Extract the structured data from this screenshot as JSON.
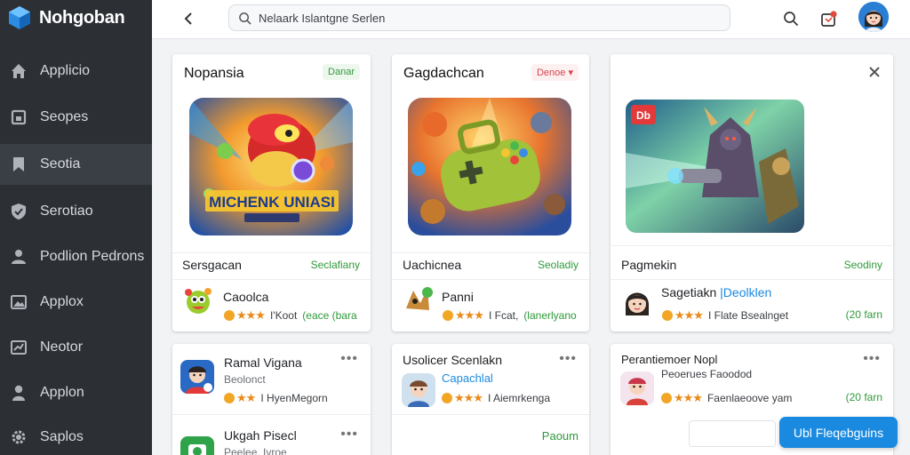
{
  "brand": {
    "name": "Nohgoban",
    "logo_icon": "cube-logo-icon",
    "color": "#2a8de3"
  },
  "sidebar": {
    "items": [
      {
        "label": "Applicio",
        "icon": "home-icon"
      },
      {
        "label": "Seopes",
        "icon": "square-icon"
      },
      {
        "label": "Seotia",
        "icon": "bookmark-icon",
        "active": true
      },
      {
        "label": "Serotiao",
        "icon": "shield-icon"
      },
      {
        "label": "Podlion Pedrons",
        "icon": "user-icon"
      },
      {
        "label": "Applox",
        "icon": "image-icon"
      },
      {
        "label": "Neotor",
        "icon": "chart-icon"
      },
      {
        "label": "Applon",
        "icon": "person-icon"
      },
      {
        "label": "Saplos",
        "icon": "gear-icon"
      }
    ]
  },
  "topbar": {
    "search_placeholder": "Nelaark Islantgne Serlen",
    "icons": [
      "chevron-left-icon",
      "search-icon",
      "notification-icon",
      "avatar"
    ]
  },
  "cards": {
    "card1": {
      "title": "Nopansia",
      "badge": "Danar",
      "sub_title": "Sersgacan",
      "sub_tag": "Seclafiany",
      "app_name": "Caoolca",
      "rating_text": "I'Koot",
      "price": "(eace (bara"
    },
    "card2": {
      "title": "Gagdachcan",
      "badge": "Denoe",
      "sub_title": "Uachicnea",
      "sub_tag": "Seoladiy",
      "app_name": "Panni",
      "rating_text": "I Fcat,",
      "price": "(lanerlyano"
    },
    "card3": {
      "art_badge": "Db",
      "sub_title": "Pagmekin",
      "sub_tag": "Seodiny",
      "app_name": "Sagetiakn",
      "app_link": "|Deolklen",
      "rating_text": "I Flate Bsealnget",
      "price": "(20 farn"
    },
    "list1": {
      "items": [
        {
          "name": "Ramal Vigana",
          "sub": "Beolonct",
          "rating_text": "I HyenMegorn"
        },
        {
          "name": "Ukgah Pisecl",
          "sub": "Peelee. Ivroe"
        }
      ]
    },
    "list2": {
      "title": "Usolicer Scenlakn",
      "item": {
        "name": "Capachlal",
        "rating_text": "I Aiemrkenga"
      },
      "footer_tag": "Paoum"
    },
    "list3": {
      "title": "Perantiemoer Nopl",
      "item": {
        "name": "Peoerues Faoodod",
        "rating_text": "Faenlaeoove yam",
        "price": "(20 farn"
      }
    }
  },
  "fab": {
    "label": "Ubl Fleqebguins"
  },
  "colors": {
    "accent": "#1a8ae0",
    "green": "#2e9a3a",
    "star": "#e98a1a",
    "sidebar": "#2c3035"
  }
}
